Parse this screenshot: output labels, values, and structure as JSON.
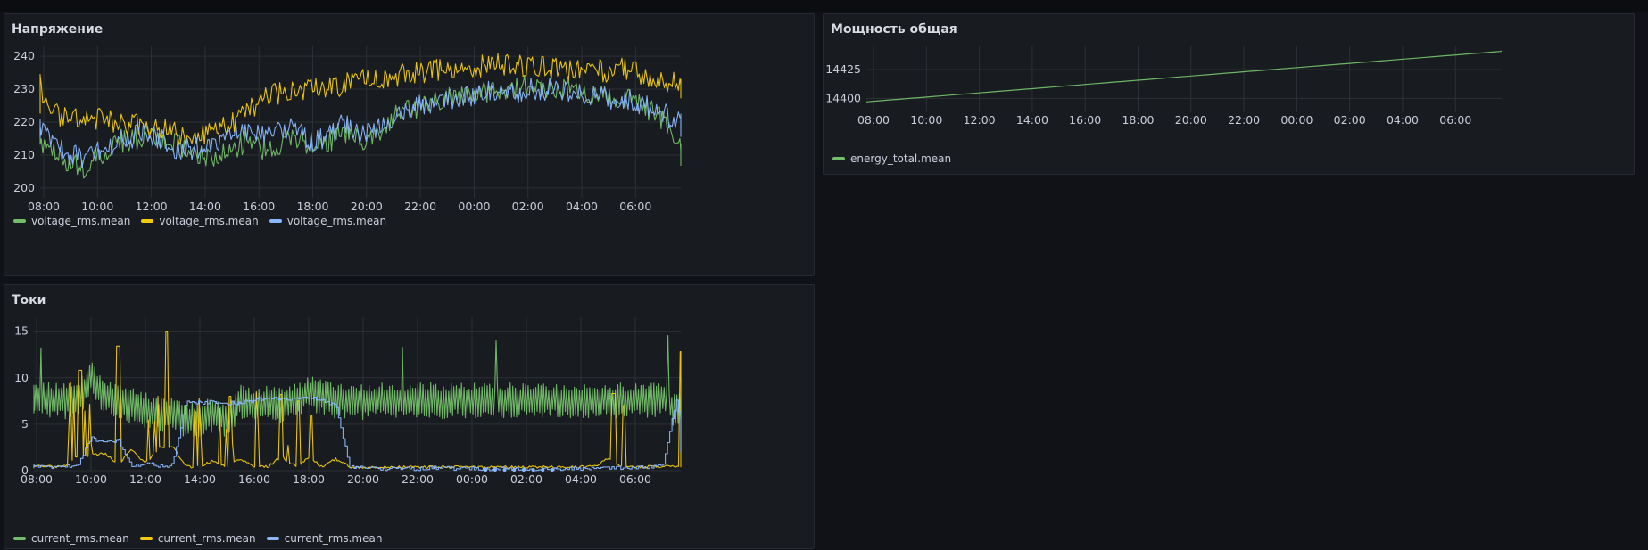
{
  "colors": {
    "green": "#73bf69",
    "yellow": "#f2cc0c",
    "blue": "#8ab8ff",
    "background": "#111217",
    "panel": "#181b1f"
  },
  "panels": {
    "voltage": {
      "title": "Напряжение",
      "legend": [
        {
          "label": "voltage_rms.mean",
          "color": "#73bf69"
        },
        {
          "label": "voltage_rms.mean",
          "color": "#f2cc0c"
        },
        {
          "label": "voltage_rms.mean",
          "color": "#8ab8ff"
        }
      ]
    },
    "power": {
      "title": "Мощность общая",
      "legend": [
        {
          "label": "energy_total.mean",
          "color": "#73bf69"
        }
      ]
    },
    "current": {
      "title": "Токи",
      "legend": [
        {
          "label": "current_rms.mean",
          "color": "#73bf69"
        },
        {
          "label": "current_rms.mean",
          "color": "#f2cc0c"
        },
        {
          "label": "current_rms.mean",
          "color": "#8ab8ff"
        }
      ]
    }
  },
  "chart_data": [
    {
      "id": "voltage",
      "type": "line",
      "title": "Напряжение",
      "x_ticks": [
        "08:00",
        "10:00",
        "12:00",
        "14:00",
        "16:00",
        "18:00",
        "20:00",
        "22:00",
        "00:00",
        "02:00",
        "04:00",
        "06:00"
      ],
      "y_ticks": [
        200,
        210,
        220,
        230,
        240
      ],
      "ylim": [
        197,
        243
      ],
      "x_range_hours": [
        -0.5,
        24.0
      ],
      "grid": true,
      "legend_position": "bottom-left",
      "series": [
        {
          "name": "voltage_rms.mean",
          "color": "#73bf69",
          "x": [
            -0.5,
            0,
            0.5,
            1,
            1.5,
            2,
            2.5,
            3,
            3.5,
            4,
            4.5,
            5,
            5.5,
            6,
            6.5,
            7,
            7.5,
            8,
            8.5,
            9,
            9.5,
            10,
            10.5,
            11,
            11.5,
            12,
            12.5,
            13,
            13.5,
            14,
            14.5,
            15,
            15.5,
            16,
            16.5,
            17,
            17.5,
            18,
            18.5,
            19,
            19.5,
            20,
            20.5,
            21,
            21.5,
            22,
            22.5,
            23,
            23.5,
            23.9
          ],
          "y": [
            218,
            213,
            210,
            207,
            206,
            209,
            212,
            214,
            215,
            216,
            214,
            213,
            211,
            210,
            209,
            212,
            214,
            212,
            211,
            214,
            215,
            212,
            213,
            217,
            216,
            214,
            217,
            222,
            225,
            224,
            226,
            227,
            228,
            228,
            229,
            230,
            230,
            231,
            231,
            230,
            230,
            229,
            229,
            228,
            227,
            226,
            224,
            221,
            215,
            210
          ]
        },
        {
          "name": "voltage_rms.mean",
          "color": "#f2cc0c",
          "x": [
            -0.5,
            -0.2,
            0,
            0.5,
            1,
            1.5,
            2,
            2.5,
            3,
            3.5,
            4,
            4.5,
            5,
            5.5,
            6,
            6.5,
            7,
            7.5,
            8,
            8.5,
            9,
            9.5,
            10,
            10.5,
            11,
            11.5,
            12,
            12.5,
            13,
            13.5,
            14,
            14.5,
            15,
            15.5,
            16,
            16.5,
            17,
            17.5,
            18,
            18.5,
            19,
            19.5,
            20,
            20.5,
            21,
            21.5,
            22,
            22.5,
            23,
            23.5,
            23.9
          ],
          "y": [
            226,
            233,
            225,
            222,
            221,
            220,
            221,
            220,
            219,
            219,
            218,
            218,
            216,
            215,
            217,
            218,
            220,
            223,
            226,
            228,
            229,
            230,
            231,
            230,
            231,
            232,
            233,
            233,
            234,
            235,
            235,
            236,
            236,
            236,
            237,
            237,
            238,
            237,
            237,
            237,
            236,
            236,
            237,
            236,
            235,
            236,
            235,
            234,
            233,
            232,
            230
          ]
        },
        {
          "name": "voltage_rms.mean",
          "color": "#8ab8ff",
          "x": [
            -0.5,
            0,
            0.5,
            1,
            1.5,
            2,
            2.5,
            3,
            3.5,
            4,
            4.5,
            5,
            5.5,
            6,
            6.5,
            7,
            7.5,
            8,
            8.5,
            9,
            9.5,
            10,
            10.5,
            11,
            11.5,
            12,
            12.5,
            13,
            13.5,
            14,
            14.5,
            15,
            15.5,
            16,
            16.5,
            17,
            17.5,
            18,
            18.5,
            19,
            19.5,
            20,
            20.5,
            21,
            21.5,
            22,
            22.5,
            23,
            23.5,
            23.9
          ],
          "y": [
            219,
            218,
            214,
            210,
            209,
            211,
            213,
            215,
            216,
            216,
            214,
            212,
            212,
            211,
            213,
            217,
            218,
            216,
            216,
            218,
            217,
            214,
            215,
            219,
            218,
            216,
            219,
            222,
            224,
            225,
            226,
            227,
            227,
            228,
            229,
            229,
            229,
            230,
            230,
            230,
            229,
            229,
            228,
            227,
            227,
            226,
            225,
            223,
            220,
            219
          ]
        }
      ]
    },
    {
      "id": "power",
      "type": "line",
      "title": "Мощность общая",
      "x_ticks": [
        "08:00",
        "10:00",
        "12:00",
        "14:00",
        "16:00",
        "18:00",
        "20:00",
        "22:00",
        "00:00",
        "02:00",
        "04:00",
        "06:00"
      ],
      "y_ticks": [
        14400,
        14425
      ],
      "ylim": [
        14388,
        14445
      ],
      "x_range_hours": [
        -0.3,
        23.9
      ],
      "grid": true,
      "legend_position": "bottom-left",
      "series": [
        {
          "name": "energy_total.mean",
          "color": "#73bf69",
          "x": [
            -0.3,
            23.9
          ],
          "y": [
            14397,
            14441
          ]
        }
      ]
    },
    {
      "id": "current",
      "type": "line",
      "title": "Токи",
      "x_ticks": [
        "08:00",
        "10:00",
        "12:00",
        "14:00",
        "16:00",
        "18:00",
        "20:00",
        "22:00",
        "00:00",
        "02:00",
        "04:00",
        "06:00"
      ],
      "y_ticks": [
        0,
        5,
        10,
        15
      ],
      "ylim": [
        0,
        16.5
      ],
      "x_range_hours": [
        -0.5,
        24.0
      ],
      "grid": true,
      "legend_position": "bottom-left",
      "series": [
        {
          "name": "current_rms.mean",
          "color": "#73bf69",
          "x": [
            -0.5,
            0,
            0.5,
            1,
            1.5,
            2,
            2.5,
            3,
            3.5,
            4,
            4.5,
            5,
            5.5,
            6,
            6.5,
            7,
            7.5,
            8,
            8.5,
            9,
            9.5,
            10,
            10.5,
            11,
            11.5,
            12,
            12.5,
            13,
            13.5,
            14,
            14.5,
            15,
            15.5,
            16,
            16.5,
            17,
            17.5,
            18,
            18.5,
            19,
            19.5,
            20,
            20.5,
            21,
            21.5,
            22,
            22.5,
            23,
            23.5,
            23.9
          ],
          "y": [
            7.5,
            7.8,
            7.6,
            7.5,
            7.4,
            10,
            8,
            7.2,
            7.0,
            6.5,
            6.0,
            6.0,
            5.5,
            5.5,
            6.0,
            5.5,
            7.5,
            7.0,
            7.2,
            7.0,
            7.4,
            8.5,
            7.8,
            7.5,
            7.6,
            7.4,
            7.6,
            7.5,
            7.5,
            7.6,
            7.6,
            7.5,
            7.6,
            7.5,
            7.6,
            7.5,
            7.6,
            7.6,
            7.6,
            7.6,
            7.5,
            7.6,
            7.6,
            7.6,
            7.5,
            7.6,
            7.6,
            7.7,
            6.5,
            8.5
          ],
          "amplitude": 1.6
        },
        {
          "name": "current_rms.mean",
          "color": "#f2cc0c",
          "x": [
            -0.5,
            0,
            0.5,
            1,
            1.5,
            2,
            2.5,
            3,
            3.5,
            4,
            4.5,
            5,
            5.5,
            6,
            6.5,
            7,
            7.5,
            8,
            8.5,
            9,
            9.5,
            10,
            10.5,
            11,
            11.5,
            12,
            12.5,
            13,
            13.5,
            14,
            14.5,
            15,
            15.5,
            16,
            16.5,
            17,
            17.5,
            18,
            18.5,
            19,
            19.5,
            20,
            20.5,
            21,
            21.5,
            22,
            22.5,
            23,
            23.5,
            23.9
          ],
          "y": [
            0.5,
            0.8,
            0.5,
            0.4,
            8,
            9,
            10,
            2,
            13,
            3,
            14,
            15,
            0.5,
            0.5,
            5,
            0.5,
            6,
            0.5,
            0.5,
            8,
            0.5,
            7,
            0.4,
            6,
            0.3,
            0.2,
            0.3,
            0.2,
            0.2,
            0.2,
            0.2,
            0.2,
            0.3,
            0.2,
            0.2,
            0.2,
            0.2,
            0.2,
            0.2,
            0.3,
            0.3,
            0.4,
            0.5,
            7,
            0.5,
            0.4,
            0.4,
            0.5,
            0.6,
            1.0
          ],
          "peaks": [
            [
              1.2,
              9.5
            ],
            [
              1.6,
              10.8
            ],
            [
              3.0,
              13.4
            ],
            [
              4.8,
              15
            ],
            [
              6.0,
              7.8
            ],
            [
              7.1,
              8.0
            ],
            [
              8.1,
              8.5
            ],
            [
              9.0,
              8.2
            ],
            [
              9.6,
              7.5
            ],
            [
              10.1,
              6.0
            ],
            [
              21.2,
              8.3
            ],
            [
              21.6,
              7.0
            ],
            [
              23.7,
              12.8
            ],
            [
              23.85,
              10.0
            ]
          ]
        },
        {
          "name": "current_rms.mean",
          "color": "#8ab8ff",
          "x": [
            -0.5,
            0,
            0.5,
            1,
            1.5,
            2,
            2.5,
            3,
            3.5,
            4,
            4.5,
            5,
            5.5,
            6,
            6.5,
            7,
            7.5,
            8,
            8.5,
            9,
            9.5,
            10,
            10.5,
            11,
            11.5,
            12,
            12.5,
            13,
            13.5,
            14,
            14.5,
            15,
            15.5,
            16,
            16.5,
            17,
            17.5,
            18,
            18.5,
            19,
            19.5,
            20,
            20.5,
            21,
            21.5,
            22,
            22.5,
            23,
            23.5,
            23.9
          ],
          "y": [
            0.5,
            0.5,
            0.4,
            0.5,
            0.6,
            3.5,
            3.0,
            3.2,
            0.5,
            0.8,
            0.5,
            0.6,
            7.5,
            7.3,
            7.4,
            7.3,
            7.3,
            7.6,
            7.8,
            7.6,
            7.7,
            7.9,
            7.6,
            7.0,
            0.4,
            0.3,
            0.2,
            0.2,
            0.2,
            0.2,
            0.3,
            0.3,
            0.2,
            0.2,
            0.2,
            0.2,
            0.2,
            0.2,
            0.2,
            0.2,
            0.2,
            0.2,
            0.3,
            0.3,
            0.3,
            0.3,
            0.4,
            0.5,
            7.6,
            2.0
          ]
        }
      ]
    }
  ]
}
